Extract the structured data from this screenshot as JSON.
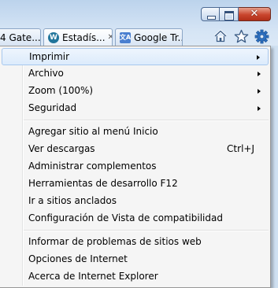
{
  "window": {
    "minimize_icon": "minimize-icon",
    "maximize_icon": "maximize-icon",
    "close_glyph": "✕"
  },
  "tabs": [
    {
      "label": "4 Gate...",
      "icon": ""
    },
    {
      "label": "Estadís...",
      "icon": "wordpress-icon",
      "close": "✕"
    },
    {
      "label": "Google Tr...",
      "icon": "google-translate-icon"
    }
  ],
  "command_icons": [
    "home-icon",
    "favorites-star-icon",
    "tools-gear-icon"
  ],
  "menu": {
    "group1": [
      {
        "label": "Imprimir",
        "submenu": true
      },
      {
        "label": "Archivo",
        "submenu": true
      },
      {
        "label": "Zoom (100%)",
        "submenu": true
      },
      {
        "label": "Seguridad",
        "submenu": true
      }
    ],
    "group2": [
      {
        "label": "Agregar sitio al menú Inicio",
        "shortcut": ""
      },
      {
        "label": "Ver descargas",
        "shortcut": "Ctrl+J"
      },
      {
        "label": "Administrar complementos",
        "shortcut": ""
      },
      {
        "label": "Herramientas de desarrollo F12",
        "shortcut": ""
      },
      {
        "label": "Ir a sitios anclados",
        "shortcut": ""
      },
      {
        "label": "Configuración de Vista de compatibilidad",
        "shortcut": ""
      }
    ],
    "group3": [
      {
        "label": "Informar de problemas de sitios web"
      },
      {
        "label": "Opciones de Internet"
      },
      {
        "label": "Acerca de Internet Explorer"
      }
    ]
  }
}
